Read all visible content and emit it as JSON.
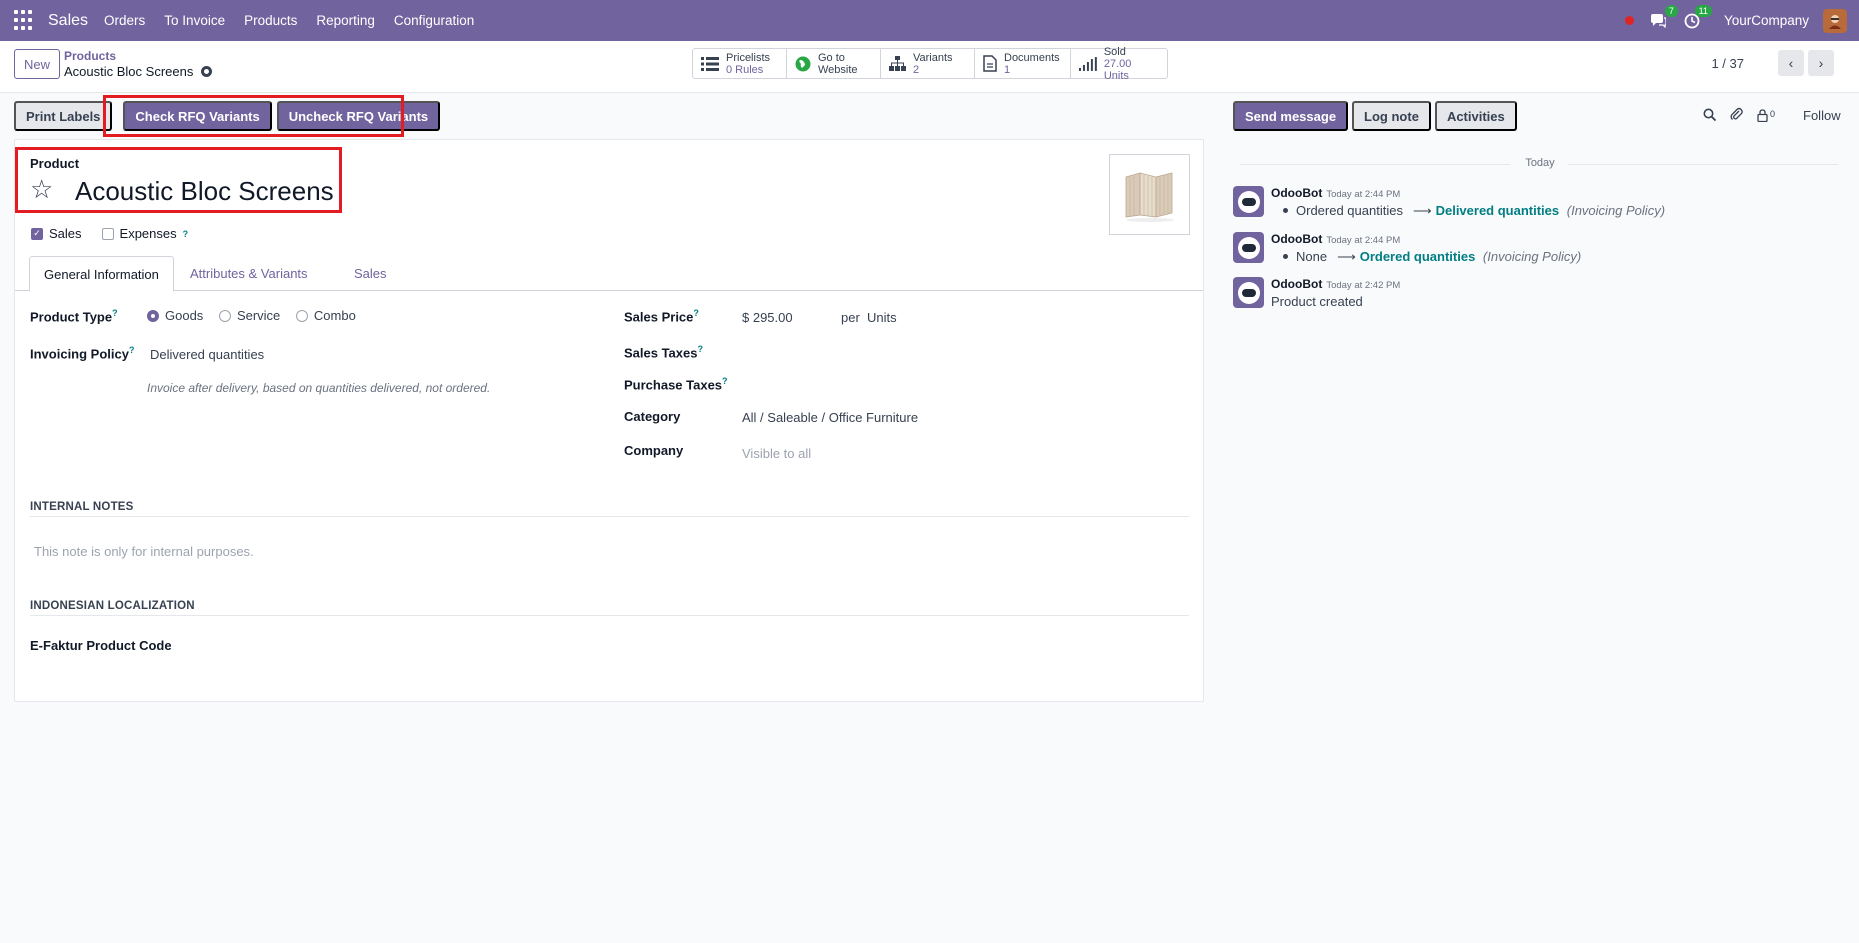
{
  "navbar": {
    "brand": "Sales",
    "menu": [
      "Orders",
      "To Invoice",
      "Products",
      "Reporting",
      "Configuration"
    ],
    "messages_badge": "7",
    "activities_badge": "11",
    "company": "YourCompany"
  },
  "control_panel": {
    "new_label": "New",
    "breadcrumb_parent": "Products",
    "breadcrumb_current": "Acoustic Bloc Screens",
    "smart_buttons": [
      {
        "label": "Pricelists",
        "value": "0 Rules",
        "icon": "list-icon"
      },
      {
        "label": "Go to",
        "value": "Website",
        "icon": "globe-icon"
      },
      {
        "label": "Variants",
        "value": "2",
        "icon": "sitemap-icon"
      },
      {
        "label": "Documents",
        "value": "1",
        "icon": "document-icon"
      },
      {
        "label": "Sold",
        "value": "27.00 Units",
        "icon": "bar-chart-icon"
      }
    ],
    "pager": "1 / 37"
  },
  "actions": {
    "print_labels": "Print Labels",
    "check_rfq": "Check RFQ Variants",
    "uncheck_rfq": "Uncheck RFQ Variants"
  },
  "product": {
    "label": "Product",
    "name": "Acoustic Bloc Screens",
    "sales_checkbox": "Sales",
    "expenses_checkbox": "Expenses",
    "help_mark": "?"
  },
  "tabs": [
    "General Information",
    "Attributes & Variants",
    "Sales"
  ],
  "general": {
    "product_type_label": "Product Type",
    "product_type_options": [
      "Goods",
      "Service",
      "Combo"
    ],
    "invoicing_policy_label": "Invoicing Policy",
    "invoicing_policy_value": "Delivered quantities",
    "invoicing_hint": "Invoice after delivery, based on quantities delivered, not ordered.",
    "sales_price_label": "Sales Price",
    "sales_price_value": "$ 295.00",
    "per_label": "per",
    "uom": "Units",
    "sales_taxes_label": "Sales Taxes",
    "purchase_taxes_label": "Purchase Taxes",
    "category_label": "Category",
    "category_value": "All / Saleable / Office Furniture",
    "company_label": "Company",
    "company_placeholder": "Visible to all",
    "internal_notes_title": "INTERNAL NOTES",
    "internal_notes_placeholder": "This note is only for internal purposes.",
    "localization_title": "INDONESIAN LOCALIZATION",
    "efaktur_label": "E-Faktur Product Code"
  },
  "chatter": {
    "send_message": "Send message",
    "log_note": "Log note",
    "activities": "Activities",
    "followers_count": "0",
    "follow": "Follow",
    "today": "Today",
    "messages": [
      {
        "author": "OdooBot",
        "time": "Today at 2:44 PM",
        "old": "Ordered quantities",
        "new": "Delivered quantities",
        "field": "(Invoicing Policy)"
      },
      {
        "author": "OdooBot",
        "time": "Today at 2:44 PM",
        "old": "None",
        "new": "Ordered quantities",
        "field": "(Invoicing Policy)"
      },
      {
        "author": "OdooBot",
        "time": "Today at 2:42 PM",
        "body": "Product created"
      }
    ]
  },
  "colors": {
    "brand": "#71639e",
    "link": "#017e84",
    "highlight": "#e31b23"
  }
}
